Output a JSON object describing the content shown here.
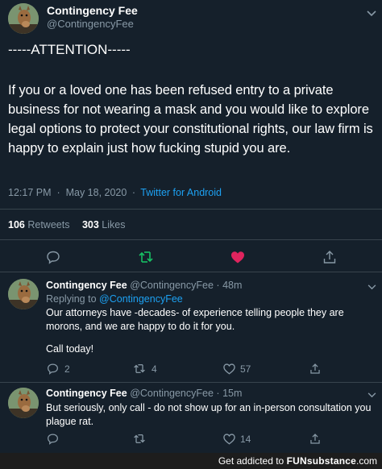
{
  "main_tweet": {
    "display_name": "Contingency Fee",
    "handle": "@ContingencyFee",
    "attention": "-----ATTENTION-----",
    "body": "If you or a loved one has been refused entry to a private business for not wearing a mask and you would like to explore legal options to protect your constitutional rights, our law firm is happy to explain just how fucking stupid you are.",
    "time": "12:17 PM",
    "date": "May 18, 2020",
    "separator": "·",
    "source": "Twitter for Android",
    "retweets_count": "106",
    "retweets_label": "Retweets",
    "likes_count": "303",
    "likes_label": "Likes",
    "icons": [
      "reply-icon",
      "retweet-icon-green",
      "like-icon-filled-pink",
      "share-icon"
    ],
    "colors": {
      "retweet": "#17bf63",
      "like": "#e0245e",
      "link": "#1da1f2"
    }
  },
  "replies": [
    {
      "display_name": "Contingency Fee",
      "handle": "@ContingencyFee",
      "separator": "·",
      "age": "48m",
      "replying_prefix": "Replying to",
      "replying_to": "@ContingencyFee",
      "text": "Our attorneys have -decades- of experience telling people they are morons, and we are happy to do it for you.",
      "text2": "Call today!",
      "reply_count": "2",
      "retweet_count": "4",
      "like_count": "57"
    },
    {
      "display_name": "Contingency Fee",
      "handle": "@ContingencyFee",
      "separator": "·",
      "age": "15m",
      "text": "But seriously, only call - do not show up for an in-person consultation you plague rat.",
      "like_count": "14"
    }
  ],
  "watermark": {
    "prefix": "Get addicted to",
    "brand": "FUNsubstance",
    "suffix": ".com"
  }
}
